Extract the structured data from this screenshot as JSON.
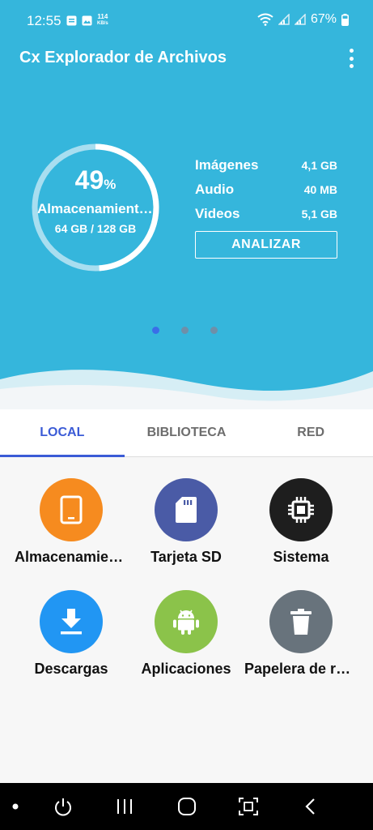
{
  "status_bar": {
    "time": "12:55",
    "net_speed_value": "114",
    "net_speed_unit": "KB/s",
    "battery": "67%"
  },
  "app_bar": {
    "title": "Cx Explorador de Archivos",
    "menu_icon": "more-vert-icon"
  },
  "storage": {
    "percent": "49",
    "percent_sign": "%",
    "percent_value": 0.49,
    "label": "Almacenamiento interno",
    "usage": "64 GB / 128 GB"
  },
  "stats": [
    {
      "name": "Imágenes",
      "value": "4,1 GB"
    },
    {
      "name": "Audio",
      "value": "40 MB"
    },
    {
      "name": "Videos",
      "value": "5,1 GB"
    }
  ],
  "analyze_label": "ANALIZAR",
  "pager": {
    "count": 3,
    "active": 0
  },
  "tabs": [
    {
      "label": "LOCAL",
      "active": true
    },
    {
      "label": "BIBLIOTECA",
      "active": false
    },
    {
      "label": "RED",
      "active": false
    }
  ],
  "items": [
    {
      "label": "Almacenamiento interno",
      "icon": "tablet-icon",
      "color": "#f68b1f"
    },
    {
      "label": "Tarjeta SD",
      "icon": "sd-card-icon",
      "color": "#4a5ba6"
    },
    {
      "label": "Sistema",
      "icon": "chip-icon",
      "color": "#1e1e1e"
    },
    {
      "label": "Descargas",
      "icon": "download-icon",
      "color": "#2196f3"
    },
    {
      "label": "Aplicaciones",
      "icon": "android-icon",
      "color": "#8bc34a"
    },
    {
      "label": "Papelera de reciclaje",
      "icon": "trash-icon",
      "color": "#68737c"
    }
  ],
  "colors": {
    "header": "#35b6dc",
    "accent": "#3b5bd6"
  }
}
